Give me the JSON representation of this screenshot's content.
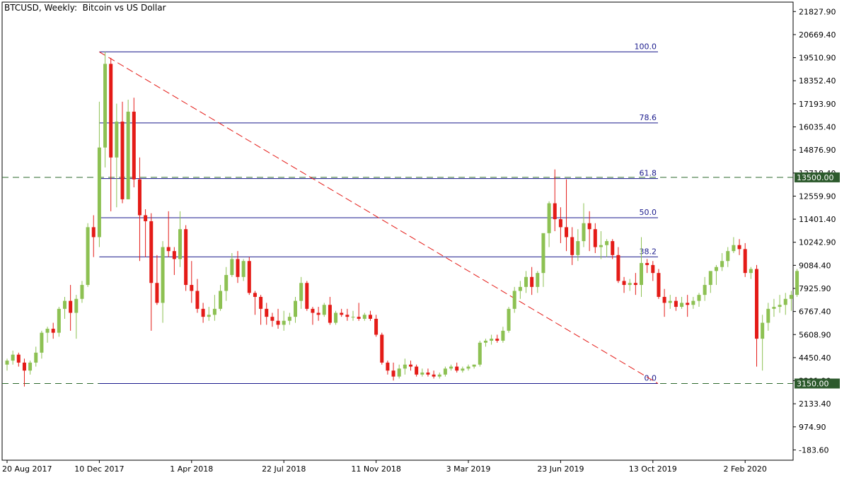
{
  "chart_data": {
    "type": "candlestick",
    "title": "BTCUSD, Weekly:  Bitcoin vs US Dollar",
    "ylim": [
      -700,
      22300
    ],
    "y_ticks": [
      21827.9,
      20669.4,
      19510.9,
      18352.4,
      17193.9,
      16035.4,
      14876.9,
      13718.4,
      12559.9,
      11401.4,
      10242.9,
      9084.4,
      7925.9,
      6767.4,
      5608.9,
      4450.4,
      3291.9,
      2133.4,
      974.9,
      -183.6
    ],
    "y_tick_labels": [
      "21827.90",
      "20669.40",
      "19510.90",
      "18352.40",
      "17193.90",
      "16035.40",
      "14876.90",
      "13718.40",
      "12559.90",
      "11401.40",
      "10242.90",
      "9084.40",
      "7925.90",
      "6767.40",
      "5608.90",
      "4450.40",
      "3291.90",
      "2133.40",
      "974.90",
      "-183.60"
    ],
    "x_ticks": [
      0,
      16,
      32,
      48,
      64,
      80,
      96,
      112,
      128
    ],
    "x_tick_labels": [
      "20 Aug 2017",
      "10 Dec 2017",
      "1 Apr 2018",
      "22 Jul 2018",
      "11 Nov 2018",
      "3 Mar 2019",
      "23 Jun 2019",
      "13 Oct 2019",
      "2 Feb 2020"
    ],
    "candles": [
      [
        4100,
        4400,
        3800,
        4300
      ],
      [
        4300,
        4800,
        4100,
        4600
      ],
      [
        4600,
        4700,
        4000,
        4200
      ],
      [
        4200,
        4400,
        3000,
        3800
      ],
      [
        3800,
        4300,
        3600,
        4200
      ],
      [
        4200,
        5000,
        4000,
        4700
      ],
      [
        4700,
        5800,
        4400,
        5700
      ],
      [
        5700,
        6000,
        5200,
        5900
      ],
      [
        5900,
        6200,
        5400,
        5700
      ],
      [
        5700,
        7000,
        5500,
        6900
      ],
      [
        6900,
        7500,
        6400,
        7300
      ],
      [
        7300,
        8100,
        5800,
        6700
      ],
      [
        6700,
        7600,
        5400,
        7400
      ],
      [
        7400,
        8300,
        7200,
        8100
      ],
      [
        8100,
        11200,
        8000,
        11000
      ],
      [
        11000,
        11600,
        9500,
        10500
      ],
      [
        10500,
        17300,
        10000,
        15000
      ],
      [
        15000,
        19800,
        14000,
        19200
      ],
      [
        19200,
        19500,
        11800,
        14500
      ],
      [
        14500,
        17200,
        12000,
        16300
      ],
      [
        16300,
        17300,
        12200,
        12400
      ],
      [
        12400,
        17400,
        12400,
        16800
      ],
      [
        16800,
        17500,
        13000,
        13400
      ],
      [
        13400,
        14500,
        9300,
        11600
      ],
      [
        11600,
        11900,
        9500,
        11300
      ],
      [
        11300,
        11700,
        5800,
        8200
      ],
      [
        8200,
        9600,
        7100,
        7200
      ],
      [
        7200,
        10300,
        6200,
        10000
      ],
      [
        10000,
        11800,
        9500,
        9800
      ],
      [
        9800,
        10000,
        8600,
        9400
      ],
      [
        9400,
        11800,
        9000,
        10900
      ],
      [
        10900,
        11100,
        7800,
        8100
      ],
      [
        8100,
        9300,
        7200,
        7800
      ],
      [
        7800,
        8400,
        6700,
        6900
      ],
      [
        6900,
        7200,
        6200,
        6500
      ],
      [
        6500,
        7000,
        6300,
        6600
      ],
      [
        6600,
        7600,
        6300,
        6900
      ],
      [
        6900,
        8100,
        6800,
        7800
      ],
      [
        7800,
        9000,
        7300,
        8600
      ],
      [
        8600,
        9700,
        8500,
        9400
      ],
      [
        9400,
        9800,
        8200,
        8500
      ],
      [
        8500,
        9400,
        8300,
        9300
      ],
      [
        9300,
        9500,
        7600,
        7700
      ],
      [
        7700,
        7800,
        6600,
        7500
      ],
      [
        7500,
        7600,
        6100,
        6900
      ],
      [
        6900,
        7200,
        6100,
        6500
      ],
      [
        6500,
        6700,
        6000,
        6300
      ],
      [
        6300,
        6900,
        5900,
        6100
      ],
      [
        6100,
        6800,
        5800,
        6300
      ],
      [
        6300,
        6700,
        6100,
        6500
      ],
      [
        6500,
        7500,
        6200,
        7300
      ],
      [
        7300,
        8500,
        6900,
        8200
      ],
      [
        8200,
        8300,
        6800,
        6900
      ],
      [
        6900,
        7000,
        6100,
        6700
      ],
      [
        6700,
        7000,
        6300,
        6600
      ],
      [
        6600,
        7200,
        6500,
        7100
      ],
      [
        7100,
        7500,
        6100,
        6200
      ],
      [
        6200,
        6800,
        6100,
        6700
      ],
      [
        6700,
        6900,
        6500,
        6600
      ],
      [
        6600,
        6900,
        6300,
        6500
      ],
      [
        6500,
        6800,
        6300,
        6500
      ],
      [
        6500,
        7200,
        6300,
        6400
      ],
      [
        6400,
        6700,
        6300,
        6600
      ],
      [
        6600,
        6800,
        6300,
        6400
      ],
      [
        6400,
        6600,
        5500,
        5600
      ],
      [
        5600,
        5700,
        4100,
        4200
      ],
      [
        4200,
        4300,
        3600,
        3800
      ],
      [
        3800,
        4200,
        3300,
        3500
      ],
      [
        3500,
        4100,
        3400,
        3900
      ],
      [
        3900,
        4400,
        3600,
        4100
      ],
      [
        4100,
        4300,
        3800,
        4000
      ],
      [
        4000,
        4100,
        3500,
        3600
      ],
      [
        3600,
        3900,
        3500,
        3700
      ],
      [
        3700,
        3900,
        3500,
        3600
      ],
      [
        3600,
        3800,
        3400,
        3500
      ],
      [
        3500,
        3700,
        3400,
        3600
      ],
      [
        3600,
        4000,
        3500,
        3900
      ],
      [
        3900,
        4100,
        3800,
        4000
      ],
      [
        4000,
        4200,
        3700,
        3800
      ],
      [
        3800,
        4000,
        3700,
        3900
      ],
      [
        3900,
        4100,
        3800,
        4000
      ],
      [
        4000,
        4100,
        3900,
        4100
      ],
      [
        4100,
        5300,
        4000,
        5200
      ],
      [
        5200,
        5400,
        5000,
        5300
      ],
      [
        5300,
        5600,
        5100,
        5400
      ],
      [
        5400,
        5600,
        5200,
        5300
      ],
      [
        5300,
        6000,
        5200,
        5800
      ],
      [
        5800,
        7000,
        5700,
        6900
      ],
      [
        6900,
        8000,
        6700,
        7800
      ],
      [
        7800,
        8300,
        7400,
        8000
      ],
      [
        8000,
        8800,
        7700,
        8500
      ],
      [
        8500,
        9000,
        7600,
        8000
      ],
      [
        8000,
        8800,
        7700,
        8700
      ],
      [
        8700,
        10500,
        8000,
        10700
      ],
      [
        10700,
        12300,
        10000,
        12200
      ],
      [
        12200,
        13900,
        10800,
        11400
      ],
      [
        11400,
        12000,
        10200,
        11000
      ],
      [
        11000,
        13400,
        9800,
        10500
      ],
      [
        10500,
        11000,
        9100,
        9600
      ],
      [
        9600,
        10900,
        9300,
        10300
      ],
      [
        10300,
        12200,
        10000,
        11200
      ],
      [
        11200,
        11800,
        9800,
        10900
      ],
      [
        10900,
        11200,
        9700,
        10000
      ],
      [
        10000,
        10800,
        9400,
        10100
      ],
      [
        10100,
        10400,
        9500,
        10300
      ],
      [
        10300,
        10400,
        9400,
        9600
      ],
      [
        9600,
        10000,
        8200,
        8300
      ],
      [
        8300,
        8500,
        7700,
        8100
      ],
      [
        8100,
        8400,
        7800,
        8200
      ],
      [
        8200,
        8700,
        7600,
        8100
      ],
      [
        8100,
        10500,
        7500,
        9200
      ],
      [
        9200,
        9400,
        8700,
        9100
      ],
      [
        9100,
        9300,
        8300,
        8700
      ],
      [
        8700,
        8900,
        7400,
        7500
      ],
      [
        7500,
        7900,
        6500,
        7200
      ],
      [
        7200,
        7600,
        6900,
        7300
      ],
      [
        7300,
        7500,
        6800,
        7000
      ],
      [
        7000,
        7500,
        6900,
        7200
      ],
      [
        7200,
        7600,
        6500,
        7100
      ],
      [
        7100,
        7500,
        6900,
        7300
      ],
      [
        7300,
        7700,
        7000,
        7600
      ],
      [
        7600,
        8500,
        7300,
        8100
      ],
      [
        8100,
        8700,
        7700,
        8800
      ],
      [
        8800,
        9100,
        8100,
        9000
      ],
      [
        9000,
        9700,
        8800,
        9300
      ],
      [
        9300,
        10000,
        9000,
        9800
      ],
      [
        9800,
        10500,
        9700,
        10100
      ],
      [
        10100,
        10400,
        9600,
        9900
      ],
      [
        9900,
        10200,
        8500,
        8700
      ],
      [
        8700,
        9000,
        8400,
        8900
      ],
      [
        8900,
        9100,
        4000,
        5400
      ],
      [
        5400,
        6600,
        3800,
        6200
      ],
      [
        6200,
        7200,
        5800,
        6900
      ],
      [
        6900,
        7400,
        6500,
        7000
      ],
      [
        7000,
        7600,
        6700,
        7100
      ],
      [
        7100,
        7700,
        6600,
        7400
      ],
      [
        7400,
        7800,
        6800,
        7600
      ],
      [
        7600,
        8900,
        7500,
        8800
      ]
    ],
    "fibonacci": {
      "high": 19800,
      "low": 3150,
      "levels": [
        {
          "ratio": 1.0,
          "label": "100.0"
        },
        {
          "ratio": 0.786,
          "label": "78.6"
        },
        {
          "ratio": 0.618,
          "label": "61.8"
        },
        {
          "ratio": 0.5,
          "label": "50.0"
        },
        {
          "ratio": 0.382,
          "label": "38.2"
        },
        {
          "ratio": 0.0,
          "label": "0.0"
        }
      ]
    },
    "horizontal_levels": [
      {
        "value": 13500,
        "label": "13500.00"
      },
      {
        "value": 3150,
        "label": "3150.00"
      }
    ],
    "colors": {
      "bull": "#8dc153",
      "bear": "#e41b17",
      "fib": "#1a1a8c",
      "trend": "#e41b17",
      "level": "#2d6a2d",
      "level_label_bg": "#2d5a2d",
      "axis": "#000000"
    }
  }
}
